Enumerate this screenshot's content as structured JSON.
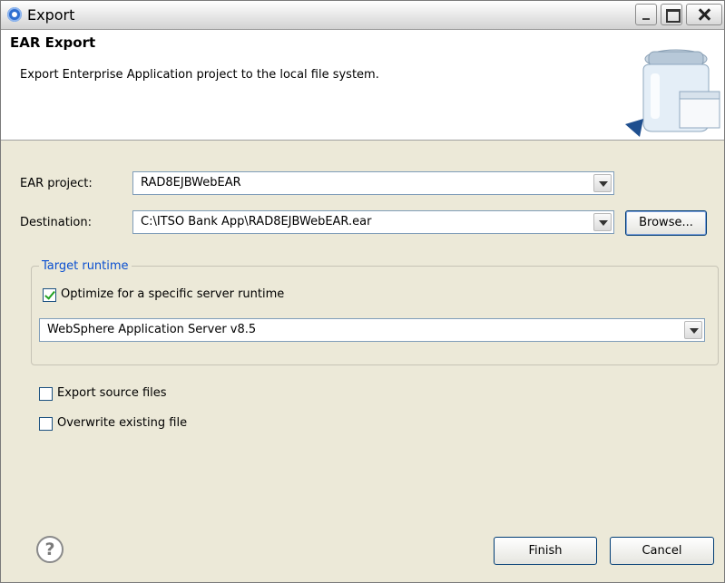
{
  "window": {
    "title": "Export"
  },
  "header": {
    "title": "EAR Export",
    "description": "Export Enterprise Application project to the local file system."
  },
  "form": {
    "ear_project": {
      "label": "EAR project:",
      "value": "RAD8EJBWebEAR"
    },
    "destination": {
      "label": "Destination:",
      "value": "C:\\ITSO Bank App\\RAD8EJBWebEAR.ear",
      "browse_label": "Browse..."
    }
  },
  "target_runtime": {
    "group_label": "Target runtime",
    "optimize": {
      "label": "Optimize for a specific server runtime",
      "checked": true
    },
    "runtime_value": "WebSphere Application Server v8.5"
  },
  "options": {
    "export_source": {
      "label": "Export source files",
      "checked": false
    },
    "overwrite": {
      "label": "Overwrite existing file",
      "checked": false
    }
  },
  "footer": {
    "help_symbol": "?",
    "finish_label": "Finish",
    "cancel_label": "Cancel"
  },
  "icons": {
    "app": "eclipse-icon",
    "wizard": "jar-export-wizard-icon",
    "help": "help-icon"
  },
  "colors": {
    "title_bar": "#e6e6e6",
    "dialog_bg": "#ece9d8",
    "group_title": "#0a4fd0",
    "check_mark": "#21a121",
    "button_border": "#003c74"
  }
}
